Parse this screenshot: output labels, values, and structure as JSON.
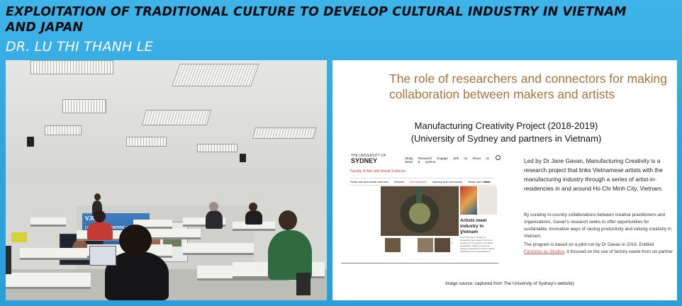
{
  "header": {
    "title": "EXPLOITATION OF TRADITIONAL CULTURE TO DEVELOP CULTURAL INDUSTRY IN VIETNAM AND JAPAN",
    "author": "DR. LU THI THANH LE"
  },
  "photo": {
    "banner_logo": "VJU",
    "banner_text": "LECTURER SCIENTIFIC C... VNU - VIETNAM JAPAN..."
  },
  "slide": {
    "heading": "The role of researchers and connectors for making collaboration between makers and artists",
    "project_title": "Manufacturing Creativity Project (2018-2019)",
    "project_partners": "(University of Sydney and  partners in Vietnam)",
    "website": {
      "logo_small": "THE UNIVERSITY OF",
      "logo_big": "SYDNEY",
      "nav": [
        "Study",
        "Research",
        "Engage with us",
        "About us",
        "News & opinion"
      ],
      "faculty": "Faculty of Arts and Social Sciences",
      "menu": [
        "Study arts and social sciences",
        "Schools",
        "Our research",
        "Industry and community",
        "News and events"
      ],
      "menu_more": "More",
      "feature_title": "Artists meet industry in Vietnam",
      "feature_text": "The University of Sydney is pioneering new research into how creativity and innovation can boost sustainable, cultural, social and industry productivity for both creative practitioners and manufacturers."
    },
    "paragraph1": "Led by Dr Jane Gavan, Manufacturing Creativity is a research project that links Vietnamese artists with the manufacturing industry through a series of artist-in-residencies in and around Ho Chi Minh City, Vietnam.",
    "paragraph2": "By curating in-country collaborations between creative practitioners and organisations, Gavan's research seeks to offer opportunities for sustainable, innovative ways of raising productivity and valuing creativity in Vietnam.",
    "paragraph3_before": "The program is based on a pilot run by Dr Gavan in 2016. Entitled ",
    "paragraph3_link": "Factories as Studios",
    "paragraph3_after": ", it focused on the use of factory waste from six partner",
    "source": "Image source: captured from The University of Sydney's website)"
  },
  "colors": {
    "background": "#2ea6e0",
    "heading": "#a6733a",
    "accent_red": "#c0392b"
  }
}
